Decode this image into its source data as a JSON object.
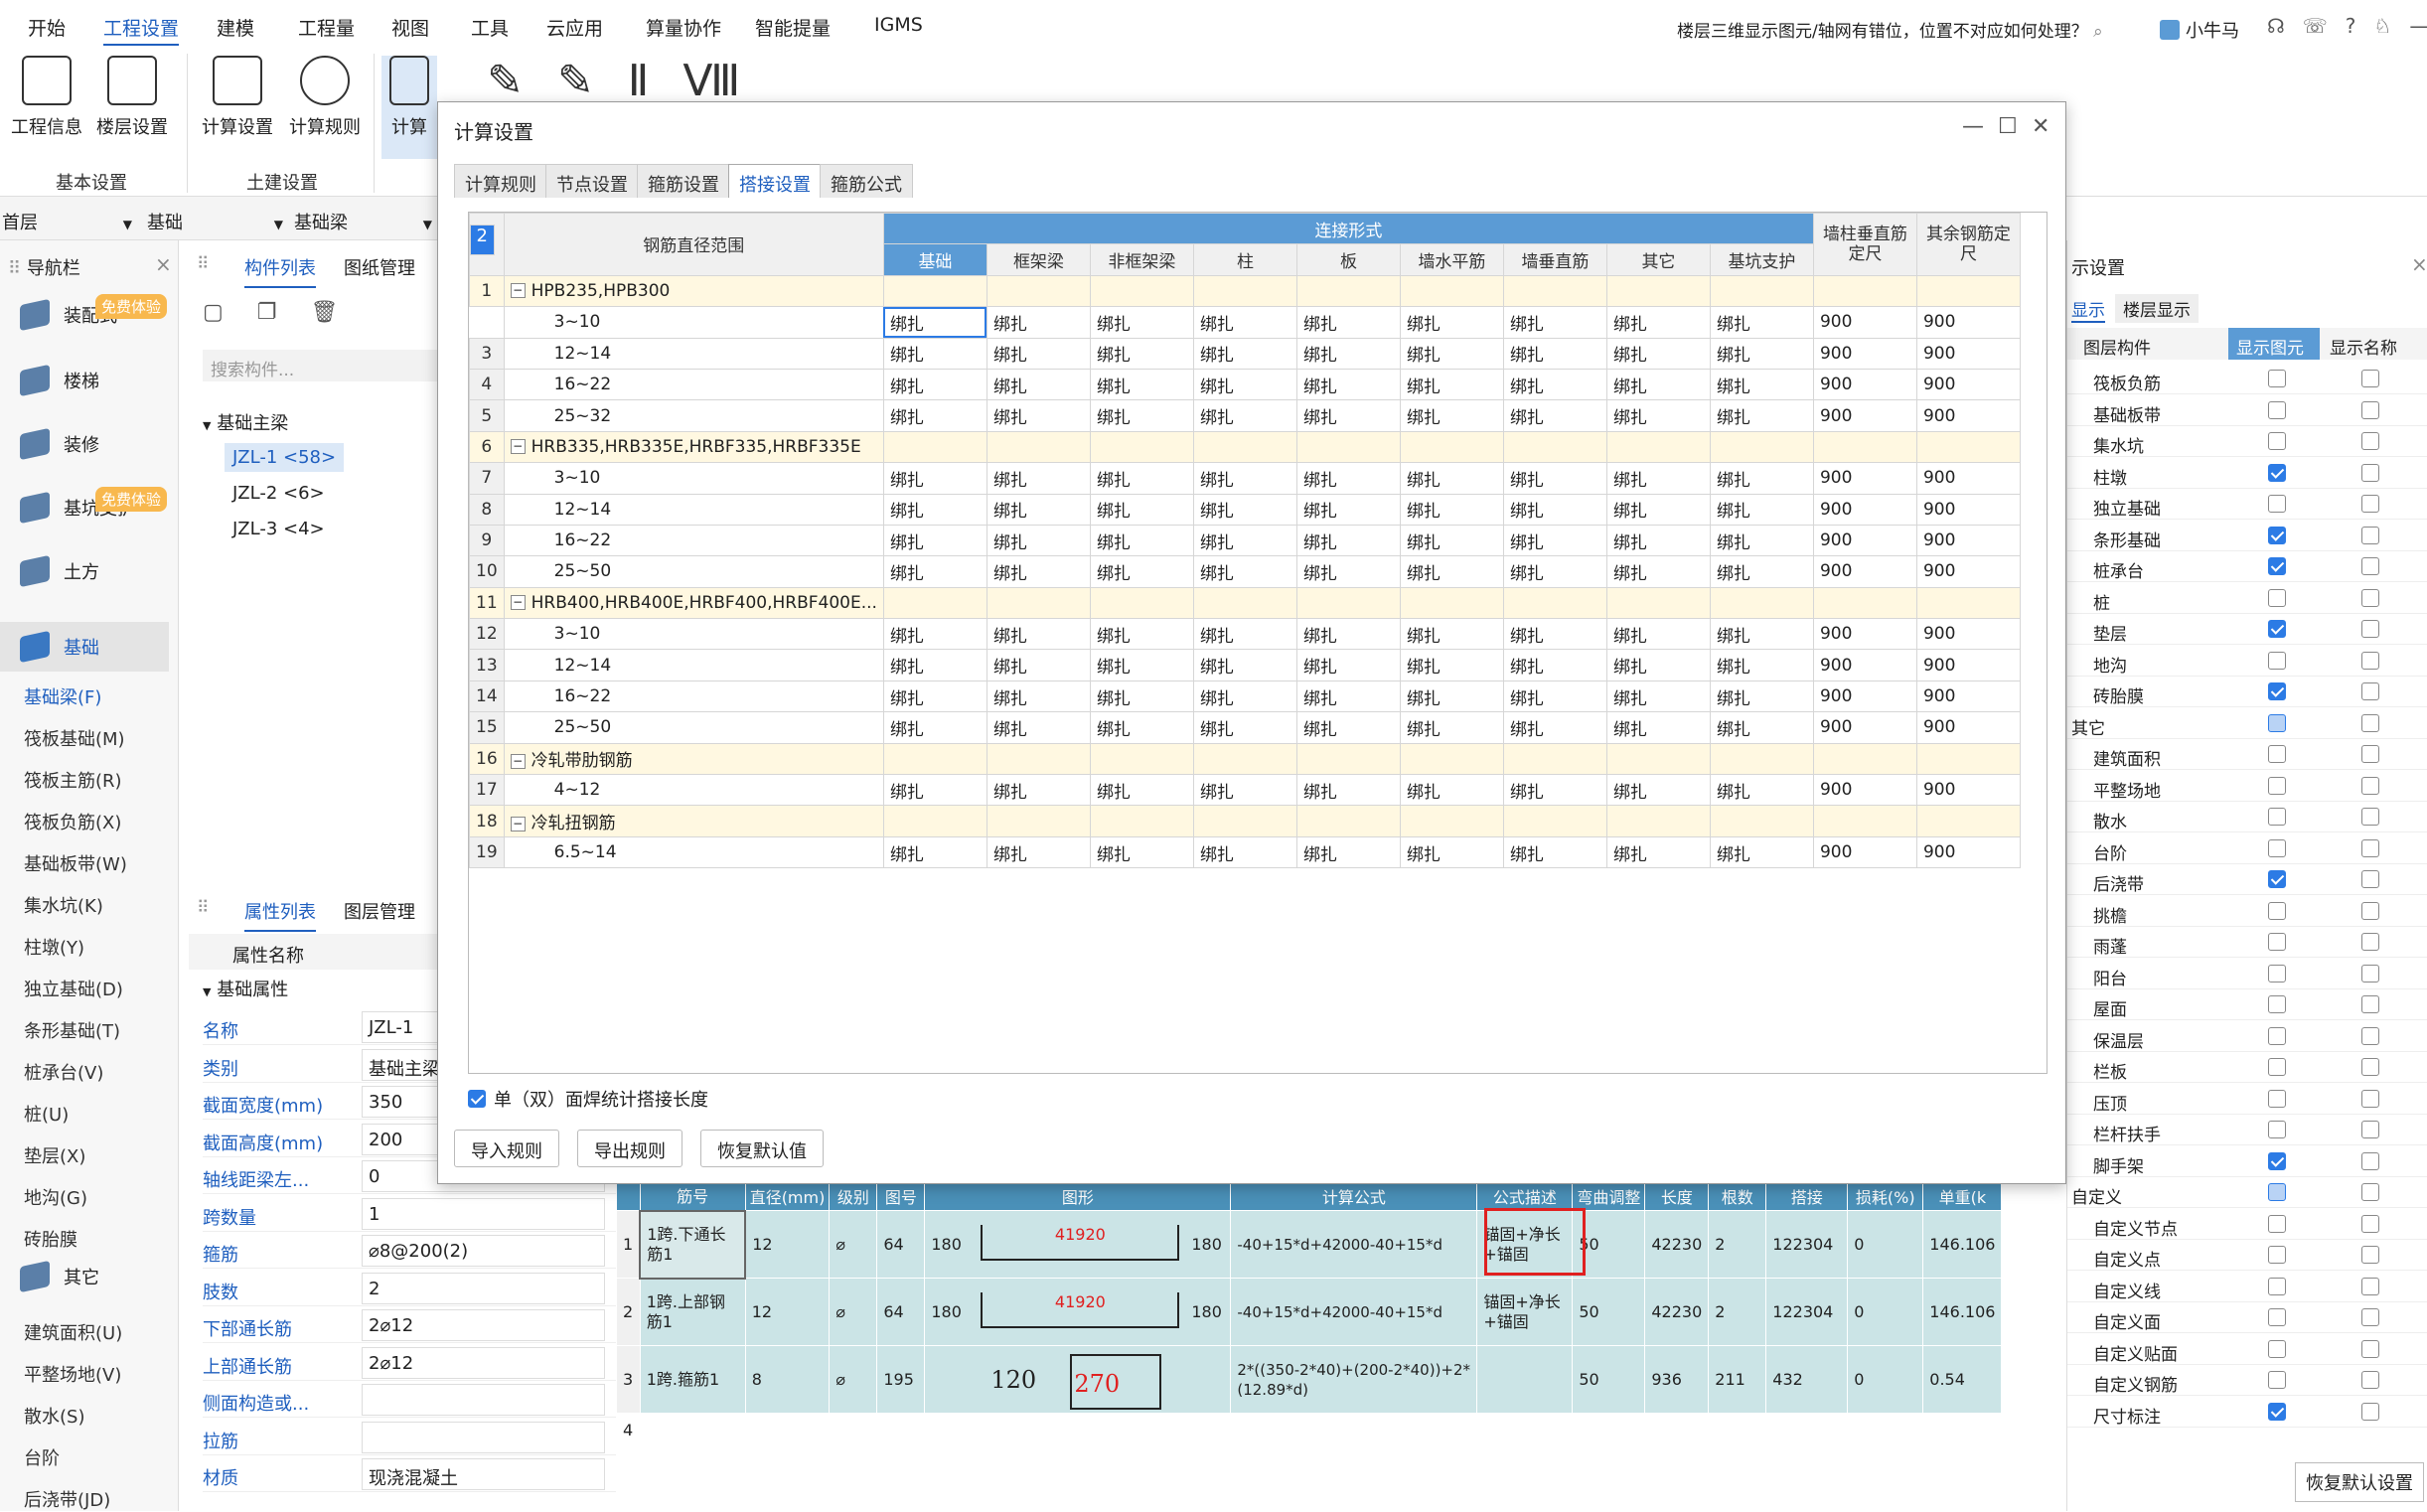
{
  "menu": [
    "开始",
    "工程设置",
    "建模",
    "工程量",
    "视图",
    "工具",
    "云应用",
    "算量协作",
    "智能提量",
    "IGMS"
  ],
  "menu_active": "工程设置",
  "search": {
    "text": "楼层三维显示图元/轴网有错位，位置不对应如何处理？"
  },
  "user": {
    "name": "小牛马"
  },
  "ribbon": {
    "buttons": [
      "工程信息",
      "楼层设置",
      "计算设置",
      "计算规则",
      "计算"
    ],
    "groups": [
      "基本设置",
      "土建设置"
    ]
  },
  "selectors": {
    "floor": "首层",
    "category": "基础",
    "element": "基础梁"
  },
  "nav": {
    "title": "导航栏",
    "badge": "免费体验",
    "items": [
      "装配式",
      "楼梯",
      "装修",
      "基坑支护",
      "土方",
      "基础",
      "其它"
    ],
    "sub_items": [
      "基础梁(F)",
      "筏板基础(M)",
      "筏板主筋(R)",
      "筏板负筋(X)",
      "基础板带(W)",
      "集水坑(K)",
      "柱墩(Y)",
      "独立基础(D)",
      "条形基础(T)",
      "桩承台(V)",
      "桩(U)",
      "垫层(X)",
      "地沟(G)",
      "砖胎膜"
    ],
    "sub_items2": [
      "建筑面积(U)",
      "平整场地(V)",
      "散水(S)",
      "台阶",
      "后浇带(JD)"
    ]
  },
  "component_panel": {
    "tabs": [
      "构件列表",
      "图纸管理"
    ],
    "search_placeholder": "搜索构件...",
    "group": "基础主梁",
    "items": [
      "JZL-1 <58>",
      "JZL-2 <6>",
      "JZL-3 <4>"
    ]
  },
  "property_panel": {
    "tabs": [
      "属性列表",
      "图层管理"
    ],
    "header": "属性名称",
    "group": "基础属性",
    "rows": [
      {
        "k": "名称",
        "v": "JZL-1"
      },
      {
        "k": "类别",
        "v": "基础主梁"
      },
      {
        "k": "截面宽度(mm)",
        "v": "350"
      },
      {
        "k": "截面高度(mm)",
        "v": "200"
      },
      {
        "k": "轴线距梁左...",
        "v": "0"
      },
      {
        "k": "跨数量",
        "v": "1"
      },
      {
        "k": "箍筋",
        "v": "⌀8@200(2)"
      },
      {
        "k": "肢数",
        "v": "2"
      },
      {
        "k": "下部通长筋",
        "v": "2⌀12"
      },
      {
        "k": "上部通长筋",
        "v": "2⌀12"
      },
      {
        "k": "侧面构造或...",
        "v": ""
      },
      {
        "k": "拉筋",
        "v": ""
      },
      {
        "k": "材质",
        "v": "现浇混凝土"
      }
    ]
  },
  "dialog": {
    "title": "计算设置",
    "tabs": [
      "计算规则",
      "节点设置",
      "箍筋设置",
      "搭接设置",
      "箍筋公式"
    ],
    "active_tab": "搭接设置",
    "header": {
      "range": "钢筋直径范围",
      "connection": "连接形式",
      "cols": [
        "基础",
        "框架梁",
        "非框架梁",
        "柱",
        "板",
        "墙水平筋",
        "墙垂直筋",
        "其它",
        "基坑支护"
      ],
      "col_wall": "墙柱垂直筋定尺",
      "col_other": "其余钢筋定尺"
    },
    "rows": [
      {
        "n": "1",
        "cat": true,
        "label": "HPB235,HPB300"
      },
      {
        "n": "2",
        "label": "3~10",
        "v": "绑扎",
        "a": "900",
        "b": "900"
      },
      {
        "n": "3",
        "label": "12~14",
        "v": "绑扎",
        "a": "900",
        "b": "900"
      },
      {
        "n": "4",
        "label": "16~22",
        "v": "绑扎",
        "a": "900",
        "b": "900"
      },
      {
        "n": "5",
        "label": "25~32",
        "v": "绑扎",
        "a": "900",
        "b": "900"
      },
      {
        "n": "6",
        "cat": true,
        "label": "HRB335,HRB335E,HRBF335,HRBF335E"
      },
      {
        "n": "7",
        "label": "3~10",
        "v": "绑扎",
        "a": "900",
        "b": "900"
      },
      {
        "n": "8",
        "label": "12~14",
        "v": "绑扎",
        "a": "900",
        "b": "900"
      },
      {
        "n": "9",
        "label": "16~22",
        "v": "绑扎",
        "a": "900",
        "b": "900"
      },
      {
        "n": "10",
        "label": "25~50",
        "v": "绑扎",
        "a": "900",
        "b": "900"
      },
      {
        "n": "11",
        "cat": true,
        "label": "HRB400,HRB400E,HRBF400,HRBF400E..."
      },
      {
        "n": "12",
        "label": "3~10",
        "v": "绑扎",
        "a": "900",
        "b": "900"
      },
      {
        "n": "13",
        "label": "12~14",
        "v": "绑扎",
        "a": "900",
        "b": "900"
      },
      {
        "n": "14",
        "label": "16~22",
        "v": "绑扎",
        "a": "900",
        "b": "900"
      },
      {
        "n": "15",
        "label": "25~50",
        "v": "绑扎",
        "a": "900",
        "b": "900"
      },
      {
        "n": "16",
        "cat": true,
        "label": "冷轧带肋钢筋"
      },
      {
        "n": "17",
        "label": "4~12",
        "v": "绑扎",
        "a": "900",
        "b": "900"
      },
      {
        "n": "18",
        "cat": true,
        "label": "冷轧扭钢筋"
      },
      {
        "n": "19",
        "label": "6.5~14",
        "v": "绑扎",
        "a": "900",
        "b": "900"
      }
    ],
    "checkbox_label": "单（双）面焊统计搭接长度",
    "buttons": [
      "导入规则",
      "导出规则",
      "恢复默认值"
    ]
  },
  "bottom_table": {
    "headers": [
      "筋号",
      "直径(mm)",
      "级别",
      "图号",
      "图形",
      "计算公式",
      "公式描述",
      "弯曲调整",
      "长度",
      "根数",
      "搭接",
      "损耗(%)",
      "单重(k"
    ],
    "rows": [
      {
        "idx": "1",
        "name": "1跨.下通长筋1",
        "dia": "12",
        "grade": "⌀",
        "fig": "64",
        "l": "180",
        "mid": "41920",
        "r": "180",
        "formula": "-40+15*d+42000-40+15*d",
        "desc": "锚固+净长+锚固",
        "bend": "50",
        "len": "42230",
        "count": "2",
        "lap": "122304",
        "loss": "0",
        "weight": "146.106"
      },
      {
        "idx": "2",
        "name": "1跨.上部钢筋1",
        "dia": "12",
        "grade": "⌀",
        "fig": "64",
        "l": "180",
        "mid": "41920",
        "r": "180",
        "formula": "-40+15*d+42000-40+15*d",
        "desc": "锚固+净长+锚固",
        "bend": "50",
        "len": "42230",
        "count": "2",
        "lap": "122304",
        "loss": "0",
        "weight": "146.106"
      },
      {
        "idx": "3",
        "name": "1跨.箍筋1",
        "dia": "8",
        "grade": "⌀",
        "fig": "195",
        "l": "120",
        "mid": "270",
        "r": "",
        "formula": "2*((350-2*40)+(200-2*40))+2*(12.89*d)",
        "desc": "",
        "bend": "50",
        "len": "936",
        "count": "211",
        "lap": "432",
        "loss": "0",
        "weight": "0.54"
      },
      {
        "idx": "4"
      }
    ]
  },
  "right_panel": {
    "title": "示设置",
    "tabs": [
      "显示",
      "楼层显示"
    ],
    "headers": [
      "图层构件",
      "显示图元",
      "显示名称"
    ],
    "rows": [
      {
        "l": "筏板负筋",
        "a": 0,
        "b": 0
      },
      {
        "l": "基础板带",
        "a": 0,
        "b": 0
      },
      {
        "l": "集水坑",
        "a": 0,
        "b": 0
      },
      {
        "l": "柱墩",
        "a": 1,
        "b": 0
      },
      {
        "l": "独立基础",
        "a": 0,
        "b": 0
      },
      {
        "l": "条形基础",
        "a": 1,
        "b": 0
      },
      {
        "l": "桩承台",
        "a": 1,
        "b": 0
      },
      {
        "l": "桩",
        "a": 0,
        "b": 0
      },
      {
        "l": "垫层",
        "a": 1,
        "b": 0
      },
      {
        "l": "地沟",
        "a": 0,
        "b": 0
      },
      {
        "l": "砖胎膜",
        "a": 1,
        "b": 0
      },
      {
        "l": "其它",
        "a": 2,
        "b": 0,
        "top": true
      },
      {
        "l": "建筑面积",
        "a": 0,
        "b": 0
      },
      {
        "l": "平整场地",
        "a": 0,
        "b": 0
      },
      {
        "l": "散水",
        "a": 0,
        "b": 0
      },
      {
        "l": "台阶",
        "a": 0,
        "b": 0
      },
      {
        "l": "后浇带",
        "a": 1,
        "b": 0
      },
      {
        "l": "挑檐",
        "a": 0,
        "b": 0
      },
      {
        "l": "雨蓬",
        "a": 0,
        "b": 0
      },
      {
        "l": "阳台",
        "a": 0,
        "b": 0
      },
      {
        "l": "屋面",
        "a": 0,
        "b": 0
      },
      {
        "l": "保温层",
        "a": 0,
        "b": 0
      },
      {
        "l": "栏板",
        "a": 0,
        "b": 0
      },
      {
        "l": "压顶",
        "a": 0,
        "b": 0
      },
      {
        "l": "栏杆扶手",
        "a": 0,
        "b": 0
      },
      {
        "l": "脚手架",
        "a": 1,
        "b": 0
      },
      {
        "l": "自定义",
        "a": 2,
        "b": 0,
        "top": true
      },
      {
        "l": "自定义节点",
        "a": 0,
        "b": 0
      },
      {
        "l": "自定义点",
        "a": 0,
        "b": 0
      },
      {
        "l": "自定义线",
        "a": 0,
        "b": 0
      },
      {
        "l": "自定义面",
        "a": 0,
        "b": 0
      },
      {
        "l": "自定义贴面",
        "a": 0,
        "b": 0
      },
      {
        "l": "自定义钢筋",
        "a": 0,
        "b": 0
      },
      {
        "l": "尺寸标注",
        "a": 1,
        "b": 0
      }
    ],
    "restore": "恢复默认设置"
  }
}
